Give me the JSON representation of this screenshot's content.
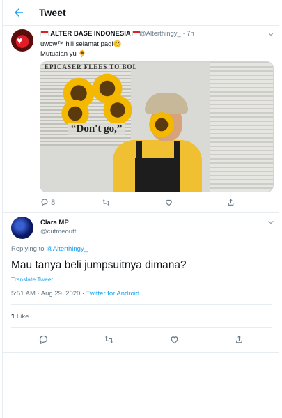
{
  "header": {
    "title": "Tweet"
  },
  "tweet1": {
    "author_name": "ALTER BASE INDONESIA",
    "author_handle": "@Alterthingy_",
    "time": "7h",
    "line1": "uwow™ hiii selamat pagi😊",
    "line2": "Mutualan yu 🌻",
    "media_headline": "EPICASER FLEES TO BOL",
    "media_quote": "“Don't go,”",
    "reply_count": "8",
    "colors": {
      "accent": "#1da1f2",
      "muted": "#657786"
    }
  },
  "tweet2": {
    "author_name": "Clara MP",
    "author_handle": "@cutmeoutt",
    "replying_prefix": "Replying to",
    "replying_to": "@Alterthingy_",
    "text": "Mau tanya beli jumpsuitnya dimana?",
    "translate_label": "Translate Tweet",
    "time_date": "5:51 AM · Aug 29, 2020 · ",
    "source": "Twitter for Android",
    "like_count": "1",
    "like_label": "Like"
  },
  "icons": [
    "back-arrow-icon",
    "chevron-down-icon",
    "reply-icon",
    "retweet-icon",
    "like-icon",
    "share-icon"
  ]
}
